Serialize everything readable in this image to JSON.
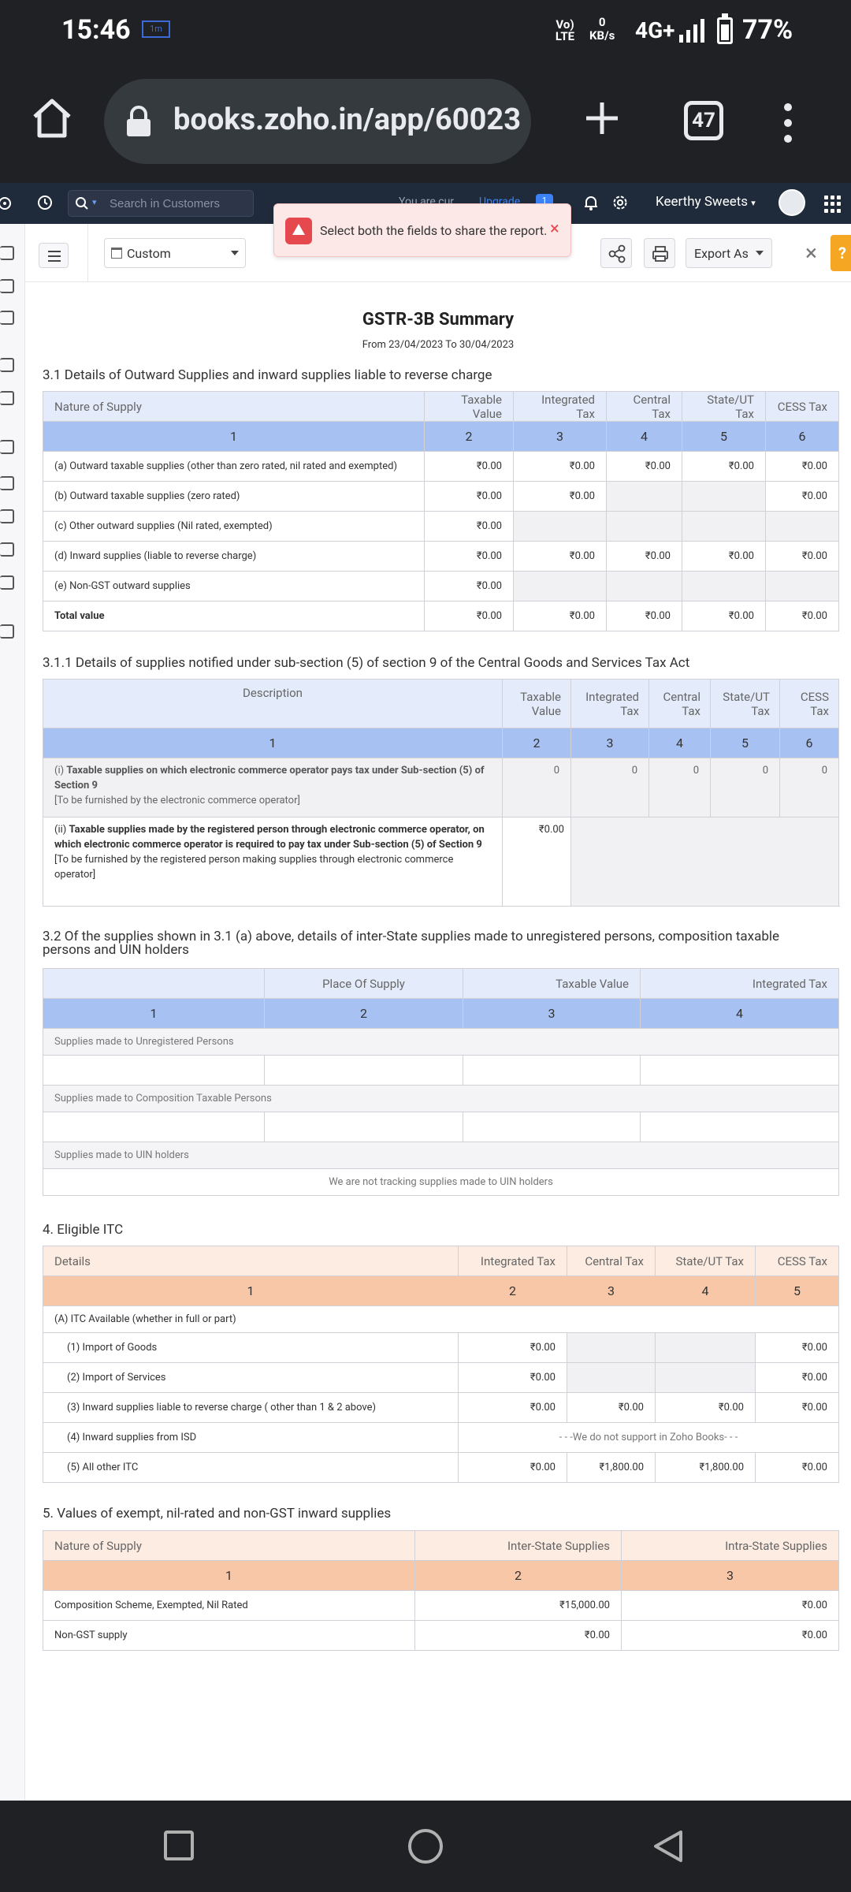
{
  "status": {
    "time": "15:46",
    "mini_icon": "1m",
    "volte": "Vo) LTE",
    "kbs_value": "0",
    "kbs_unit": "KB/s",
    "network": "4G+",
    "battery": "77%"
  },
  "browser": {
    "url": "books.zoho.in/app/60023",
    "tab_count": "47"
  },
  "topbar": {
    "search_placeholder": "Search in Customers",
    "notice": "You are cur",
    "upgrade": "Upgrade",
    "upgrade_badge": "1",
    "org_name": "Keerthy Sweets"
  },
  "header": {
    "date_filter": "Custom",
    "export_label": "Export As",
    "help_label": "?"
  },
  "toast": {
    "message": "Select both the fields to share the report."
  },
  "report": {
    "title": "GSTR-3B Summary",
    "range": "From 23/04/2023  To 30/04/2023",
    "s31": {
      "title": "3.1 Details of Outward Supplies and inward supplies liable to reverse charge",
      "headers": [
        "Nature of Supply",
        "Taxable Value",
        "Integrated Tax",
        "Central Tax",
        "State/UT Tax",
        "CESS Tax"
      ],
      "nums": [
        "1",
        "2",
        "3",
        "4",
        "5",
        "6"
      ],
      "rows": [
        {
          "label": "(a) Outward taxable supplies (other than zero rated, nil rated and exempted)",
          "v": [
            "₹0.00",
            "₹0.00",
            "₹0.00",
            "₹0.00",
            "₹0.00"
          ]
        },
        {
          "label": "(b) Outward taxable supplies (zero rated)",
          "v": [
            "₹0.00",
            "₹0.00",
            "",
            "",
            "₹0.00"
          ]
        },
        {
          "label": "(c) Other outward supplies (Nil rated, exempted)",
          "v": [
            "₹0.00",
            "",
            "",
            "",
            ""
          ]
        },
        {
          "label": "(d) Inward supplies (liable to reverse charge)",
          "v": [
            "₹0.00",
            "₹0.00",
            "₹0.00",
            "₹0.00",
            "₹0.00"
          ]
        },
        {
          "label": "(e) Non-GST outward supplies",
          "v": [
            "₹0.00",
            "",
            "",
            "",
            ""
          ]
        },
        {
          "label": "Total value",
          "v": [
            "₹0.00",
            "₹0.00",
            "₹0.00",
            "₹0.00",
            "₹0.00"
          ]
        }
      ]
    },
    "s311": {
      "title": "3.1.1 Details of supplies notified under sub-section (5) of section 9 of the Central Goods and Services Tax Act",
      "headers": [
        "Description",
        "Taxable Value",
        "Integrated Tax",
        "Central Tax",
        "State/UT Tax",
        "CESS Tax"
      ],
      "nums": [
        "1",
        "2",
        "3",
        "4",
        "5",
        "6"
      ],
      "row1_prefix": "(i) ",
      "row1_bold": "Taxable supplies on which electronic commerce operator pays tax under Sub-section (5) of Section 9",
      "row1_note": "[To be furnished by the electronic commerce operator]",
      "row1_values": [
        "0",
        "0",
        "0",
        "0",
        "0"
      ],
      "row2_prefix": "(ii) ",
      "row2_bold": "Taxable supplies made by the registered person through electronic commerce operator, on which electronic commerce operator is required to pay tax under Sub-section (5) of Section 9",
      "row2_note": "[To be furnished by the registered person making supplies through electronic commerce operator]",
      "row2_value": "₹0.00"
    },
    "s32": {
      "title": "3.2 Of the supplies shown in 3.1 (a) above, details of inter-State supplies made to unregistered persons, composition taxable persons and UIN holders",
      "headers": [
        "",
        "Place Of Supply",
        "Taxable Value",
        "Integrated Tax"
      ],
      "nums": [
        "1",
        "2",
        "3",
        "4"
      ],
      "unregistered": "Supplies made to Unregistered Persons",
      "composition": "Supplies made to Composition Taxable Persons",
      "uin": "Supplies made to UIN holders",
      "uin_note": "We are not tracking supplies made to UIN holders"
    },
    "s4": {
      "title": "4. Eligible ITC",
      "headers": [
        "Details",
        "Integrated Tax",
        "Central Tax",
        "State/UT Tax",
        "CESS Tax"
      ],
      "nums": [
        "1",
        "2",
        "3",
        "4",
        "5"
      ],
      "group_a": "(A) ITC Available (whether in full or part)",
      "rows": [
        {
          "label": "(1) Import of Goods",
          "v": [
            "₹0.00",
            "",
            "",
            "₹0.00"
          ]
        },
        {
          "label": "(2) Import of Services",
          "v": [
            "₹0.00",
            "",
            "",
            "₹0.00"
          ]
        },
        {
          "label": "(3) Inward supplies liable to reverse charge ( other than 1 & 2 above)",
          "v": [
            "₹0.00",
            "₹0.00",
            "₹0.00",
            "₹0.00"
          ]
        },
        {
          "label": "(4) Inward supplies from ISD",
          "v": [
            "- - -We do not support in Zoho Books- - -"
          ]
        },
        {
          "label": "(5) All other ITC",
          "v": [
            "₹0.00",
            "₹1,800.00",
            "₹1,800.00",
            "₹0.00"
          ]
        }
      ]
    },
    "s5": {
      "title": "5. Values of exempt, nil-rated and non-GST inward supplies",
      "headers": [
        "Nature of Supply",
        "Inter-State Supplies",
        "Intra-State Supplies"
      ],
      "nums": [
        "1",
        "2",
        "3"
      ],
      "rows": [
        {
          "label": "Composition Scheme, Exempted, Nil Rated",
          "v": [
            "₹15,000.00",
            "₹0.00"
          ]
        },
        {
          "label": "Non-GST supply",
          "v": [
            "₹0.00",
            "₹0.00"
          ]
        }
      ]
    }
  }
}
